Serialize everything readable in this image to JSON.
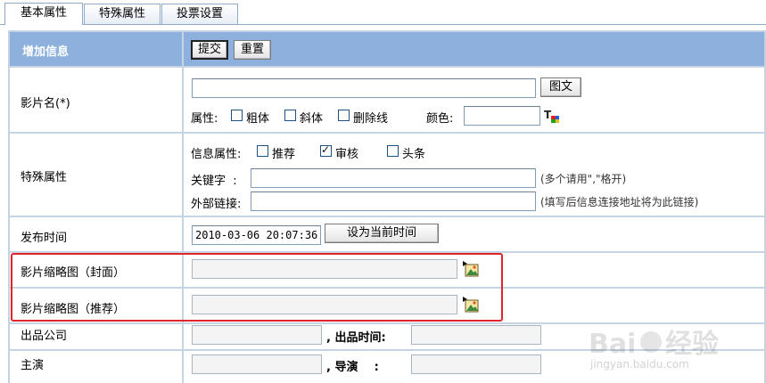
{
  "tabs": [
    {
      "label": "基本属性",
      "active": true
    },
    {
      "label": "特殊属性",
      "active": false
    },
    {
      "label": "投票设置",
      "active": false
    }
  ],
  "header": {
    "title": "增加信息",
    "submit_label": "提交",
    "reset_label": "重置"
  },
  "movie_name": {
    "label": "影片名(*)",
    "value": "",
    "button_label": "图文",
    "attrs_label": "属性:",
    "bold_label": "粗体",
    "italic_label": "斜体",
    "strike_label": "删除线",
    "color_label": "颜色:",
    "color_value": ""
  },
  "special": {
    "label": "特殊属性",
    "info_attrs_label": "信息属性:",
    "recommend_label": "推荐",
    "recommend_checked": false,
    "review_label": "审核",
    "review_checked": true,
    "headline_label": "头条",
    "headline_checked": false,
    "keywords_label": "关键字  :",
    "keywords_value": "",
    "keywords_hint": "(多个请用\",\"格开)",
    "link_label": "外部链接:",
    "link_value": "",
    "link_hint": "(填写后信息连接地址将为此链接)"
  },
  "publish": {
    "label": "发布时间",
    "value": "2010-03-06 20:07:36",
    "button_label": "设为当前时间"
  },
  "thumb_cover": {
    "label": "影片缩略图（封面）",
    "value": ""
  },
  "thumb_recommend": {
    "label": "影片缩略图（推荐）",
    "value": ""
  },
  "company": {
    "label": "出品公司",
    "value": "",
    "time_label": ", 出品时间:",
    "time_value": ""
  },
  "actors": {
    "label": "主演",
    "value": "",
    "director_label": ", 导演    :",
    "director_value": ""
  },
  "watermark": {
    "brand": "Baidu经验",
    "url": "jingyan.baidu.com"
  },
  "colors": {
    "header_bg": "#8db0dc",
    "grid_bg": "#c6d3e3",
    "highlight": "#e0262b"
  }
}
